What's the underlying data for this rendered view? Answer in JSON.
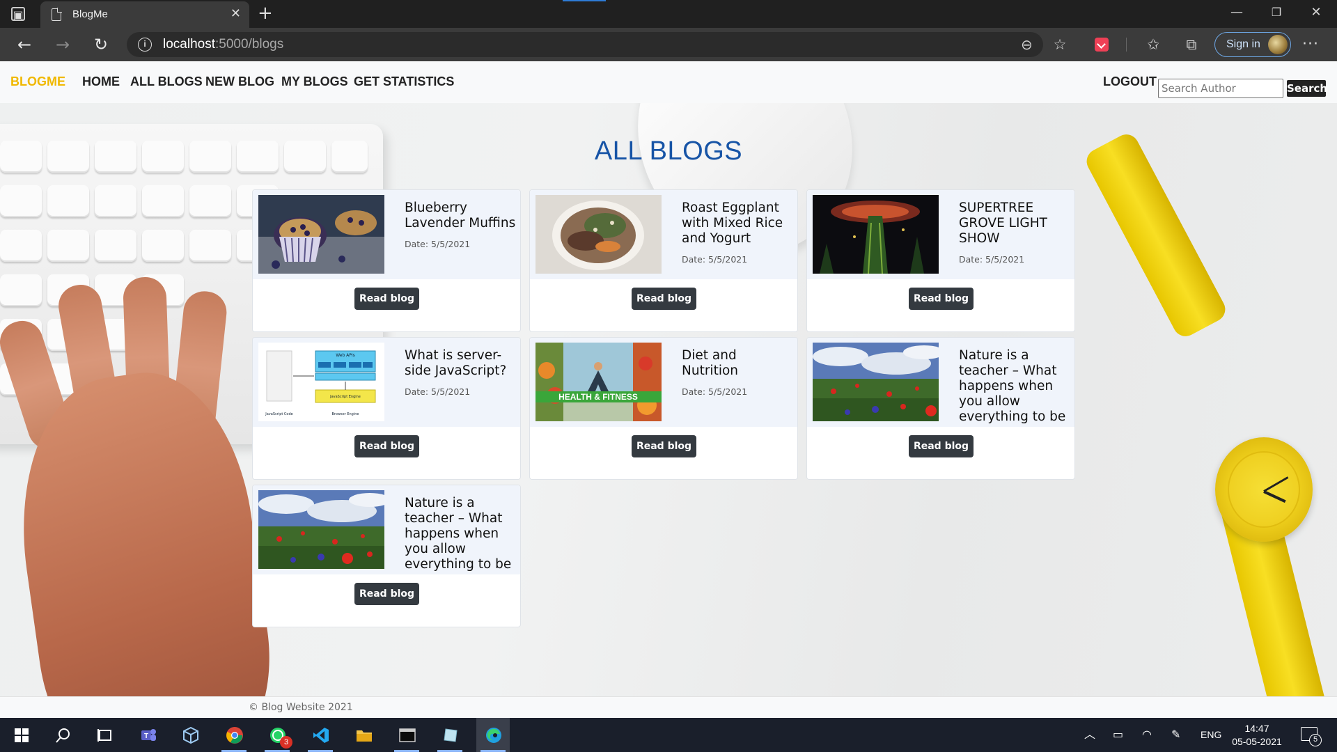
{
  "browser": {
    "tab_title": "BlogMe",
    "url_host": "localhost",
    "url_path": ":5000/blogs",
    "signin_label": "Sign in"
  },
  "site": {
    "brand": "BLOGME",
    "nav": [
      "HOME",
      "ALL BLOGS",
      "NEW BLOG",
      "MY BLOGS",
      "GET STATISTICS"
    ],
    "logout": "LOGOUT",
    "search_placeholder": "Search Author",
    "search_button": "Search"
  },
  "heading": "ALL BLOGS",
  "blogs": [
    {
      "title": "Blueberry Lavender Muffins",
      "date": "Date: 5/5/2021",
      "thumb": "muffins",
      "button": "Read blog"
    },
    {
      "title": "Roast Eggplant with Mixed Rice and Yogurt",
      "date": "Date: 5/5/2021",
      "thumb": "eggplant",
      "button": "Read blog"
    },
    {
      "title": "SUPERTREE GROVE LIGHT SHOW",
      "date": "Date: 5/5/2021",
      "thumb": "supertree",
      "button": "Read blog"
    },
    {
      "title": "What is server-side JavaScript?",
      "date": "Date: 5/5/2021",
      "thumb": "javascript",
      "button": "Read blog",
      "thumb_labels": [
        "Web APIs",
        "JavaScript Engine",
        "JavaScript Code",
        "Browser Engine"
      ]
    },
    {
      "title": "Diet and Nutrition",
      "date": "Date: 5/5/2021",
      "thumb": "health",
      "button": "Read blog",
      "thumb_labels": [
        "HEALTH & FITNESS"
      ]
    },
    {
      "title": "Nature is a teacher – What happens when you allow everything to be",
      "date": "",
      "thumb": "poppies",
      "button": "Read blog"
    },
    {
      "title": "Nature is a teacher – What happens when you allow everything to be",
      "date": "",
      "thumb": "poppies",
      "button": "Read blog"
    }
  ],
  "footer": "© Blog Website 2021",
  "taskbar": {
    "apps": [
      "windows-start",
      "search",
      "task-view",
      "teams",
      "virtualbox",
      "chrome",
      "whatsapp",
      "vscode",
      "file-explorer",
      "terminal",
      "notes",
      "edge"
    ],
    "whatsapp_badge": "3",
    "language": "ENG",
    "time": "14:47",
    "date": "05-05-2021",
    "notification_count": "5"
  }
}
